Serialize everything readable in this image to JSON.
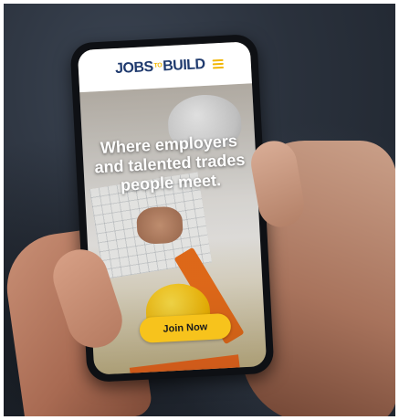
{
  "site": {
    "logo": {
      "word1": "JOBS",
      "connector": "TO",
      "word2": "BUILD"
    },
    "menu_icon": "hamburger-menu-icon",
    "headline_line1": "Where employers",
    "headline_line2": "and talented trades",
    "headline_line3": "people meet.",
    "cta_label": "Join Now"
  },
  "colors": {
    "brand_navy": "#1f3a6e",
    "brand_yellow": "#f7c31c",
    "background_dark": "#2a313c"
  }
}
